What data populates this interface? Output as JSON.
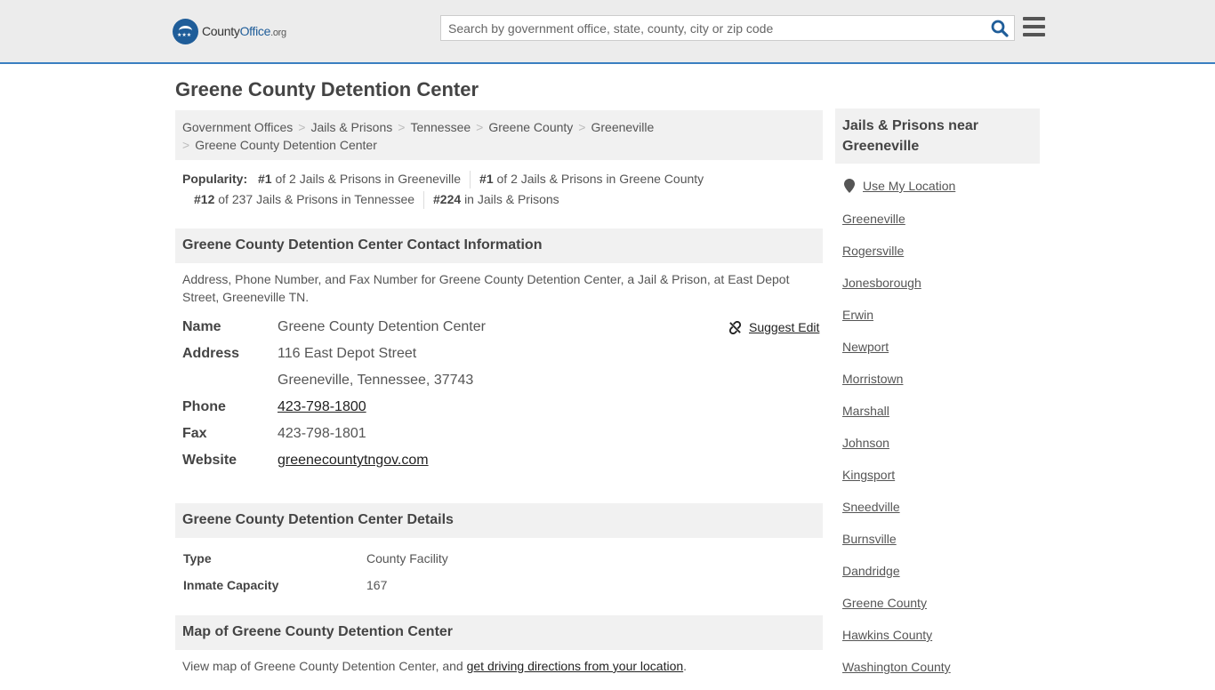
{
  "header": {
    "logo_county": "County",
    "logo_office": "Office",
    "logo_org": ".org",
    "search_placeholder": "Search by government office, state, county, city or zip code"
  },
  "page": {
    "title": "Greene County Detention Center"
  },
  "breadcrumb": [
    "Government Offices",
    "Jails & Prisons",
    "Tennessee",
    "Greene County",
    "Greeneville",
    "Greene County Detention Center"
  ],
  "popularity": {
    "label": "Popularity:",
    "items": [
      {
        "rank": "#1",
        "text": "of 2 Jails & Prisons in Greeneville"
      },
      {
        "rank": "#1",
        "text": "of 2 Jails & Prisons in Greene County"
      },
      {
        "rank": "#12",
        "text": "of 237 Jails & Prisons in Tennessee"
      },
      {
        "rank": "#224",
        "text": "in Jails & Prisons"
      }
    ]
  },
  "contact": {
    "heading": "Greene County Detention Center Contact Information",
    "intro": "Address, Phone Number, and Fax Number for Greene County Detention Center, a Jail & Prison, at East Depot Street, Greeneville TN.",
    "suggest_edit": "Suggest Edit",
    "name_label": "Name",
    "name": "Greene County Detention Center",
    "address_label": "Address",
    "address_line1": "116 East Depot Street",
    "address_line2": "Greeneville, Tennessee, 37743",
    "phone_label": "Phone",
    "phone": "423-798-1800",
    "fax_label": "Fax",
    "fax": "423-798-1801",
    "website_label": "Website",
    "website": "greenecountytngov.com"
  },
  "details": {
    "heading": "Greene County Detention Center Details",
    "rows": [
      {
        "label": "Type",
        "value": "County Facility"
      },
      {
        "label": "Inmate Capacity",
        "value": "167"
      }
    ]
  },
  "map": {
    "heading": "Map of Greene County Detention Center",
    "text": "View map of Greene County Detention Center, and ",
    "link": "get driving directions from your location",
    "suffix": "."
  },
  "sidebar": {
    "heading": "Jails & Prisons near Greeneville",
    "use_location": "Use My Location",
    "links": [
      "Greeneville",
      "Rogersville",
      "Jonesborough",
      "Erwin",
      "Newport",
      "Morristown",
      "Marshall",
      "Johnson",
      "Kingsport",
      "Sneedville",
      "Burnsville",
      "Dandridge",
      "Greene County",
      "Hawkins County",
      "Washington County"
    ]
  },
  "colors": {
    "accent": "#1f5d99",
    "header_border": "#3a7fc1"
  }
}
